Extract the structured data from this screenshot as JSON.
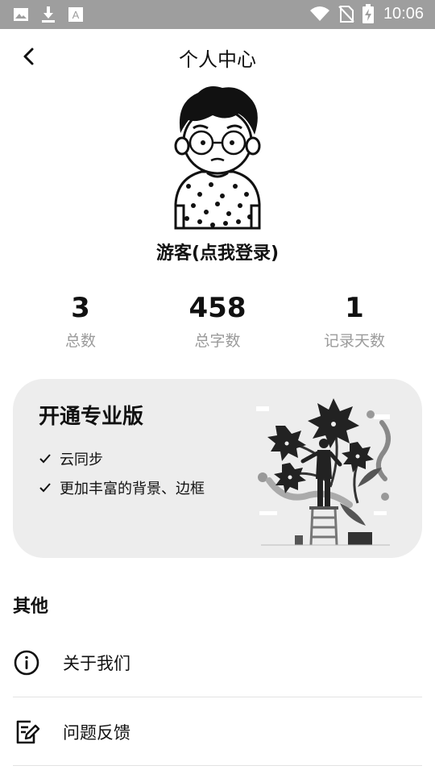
{
  "status_bar": {
    "time": "10:06",
    "icons": [
      "image-icon",
      "download-icon",
      "font-icon",
      "wifi-icon",
      "no-sim-icon",
      "battery-charging-icon"
    ]
  },
  "header": {
    "title": "个人中心",
    "back_icon": "chevron-left-icon"
  },
  "profile": {
    "username": "游客(点我登录)"
  },
  "stats": [
    {
      "value": "3",
      "label": "总数"
    },
    {
      "value": "458",
      "label": "总字数"
    },
    {
      "value": "1",
      "label": "记录天数"
    }
  ],
  "pro_card": {
    "title": "开通专业版",
    "features": [
      "云同步",
      "更加丰富的背景、边框"
    ]
  },
  "other": {
    "title": "其他",
    "items": [
      {
        "label": "关于我们",
        "icon": "info-icon"
      },
      {
        "label": "问题反馈",
        "icon": "feedback-edit-icon"
      }
    ]
  }
}
